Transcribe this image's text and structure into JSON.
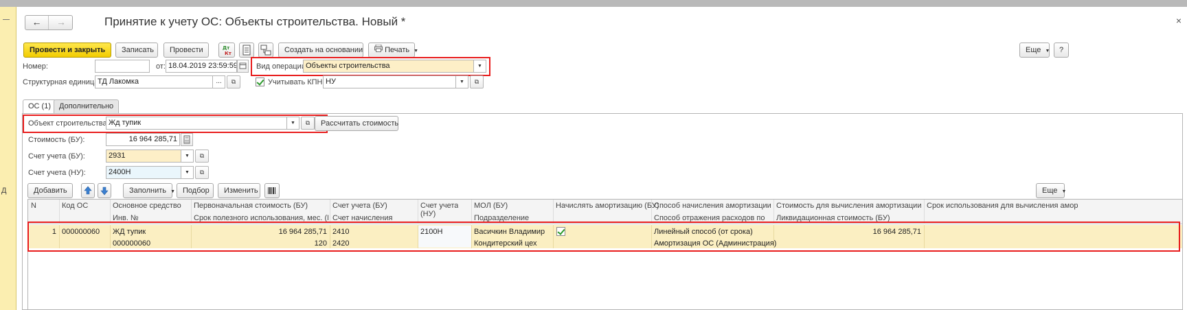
{
  "left_panel": {
    "letter": "Д"
  },
  "header": {
    "title": "Принятие к учету ОС: Объекты строительства. Новый *",
    "back_icon": "arrow-left-icon",
    "forward_icon": "arrow-right-icon",
    "close_glyph": "×"
  },
  "toolbar": {
    "post_close": "Провести и закрыть",
    "save": "Записать",
    "post": "Провести",
    "create_based": "Создать на основании",
    "print": "Печать",
    "more": "Еще",
    "help": "?"
  },
  "form": {
    "number_label": "Номер:",
    "number_value": "",
    "date_label": "от:",
    "date_value": "18.04.2019 23:59:59",
    "operation_label": "Вид операции:",
    "operation_value": "Объекты строительства",
    "unit_label": "Структурная единица:",
    "unit_value": "ТД Лакомка",
    "kpn_label": "Учитывать КПН",
    "kpn_checked": true,
    "kpn_value": "НУ"
  },
  "tabs": [
    {
      "label": "ОС (1)",
      "active": true
    },
    {
      "label": "Дополнительно",
      "active": false
    }
  ],
  "os_tab": {
    "object_label": "Объект строительства:",
    "object_value": "Жд тупик",
    "calc_button": "Рассчитать стоимость",
    "cost_label": "Стоимость (БУ):",
    "cost_value": "16 964 285,71",
    "account_bu_label": "Счет учета (БУ):",
    "account_bu_value": "2931",
    "account_nu_label": "Счет учета (НУ):",
    "account_nu_value": "2400Н"
  },
  "table_toolbar": {
    "add": "Добавить",
    "fill": "Заполнить",
    "select": "Подбор",
    "change": "Изменить",
    "more": "Еще"
  },
  "table": {
    "headers": {
      "n": "N",
      "code": "Код ОС",
      "asset": "Основное средство",
      "inv": "Инв. №",
      "initial_cost": "Первоначальная стоимость (БУ)",
      "useful_life": "Срок полезного использования, мес. (БУ)",
      "account_bu": "Счет учета (БУ)",
      "depr_account": "Счет начисления",
      "account_nu_1": "Счет учета",
      "account_nu_2": "(НУ)",
      "mol": "МОЛ (БУ)",
      "division": "Подразделение",
      "accrue": "Начислять амортизацию (БУ)",
      "method": "Способ начисления амортизации (...",
      "expense_method": "Способ отражения расходов по",
      "depr_cost": "Стоимость для вычисления амортизации (БУ)",
      "salvage": "Ликвидационная стоимость (БУ)",
      "term": "Срок использования для вычисления амор"
    },
    "rows": [
      {
        "n": "1",
        "code": "000000060",
        "asset": "ЖД тупик",
        "inv": "000000060",
        "initial_cost": "16 964 285,71",
        "useful_life": "120",
        "account_bu": "2410",
        "depr_account": "2420",
        "account_nu": "2100Н",
        "mol": "Васичкин Владимир",
        "division": "Кондитерский цех",
        "accrue": true,
        "method": "Линейный способ (от срока)",
        "expense_method": "Амортизация ОС (Администрация)",
        "depr_cost": "16 964 285,71",
        "salvage": "",
        "term": ""
      }
    ]
  },
  "colors": {
    "primary_button": "#f2cc00",
    "highlight_border": "#e81b1b",
    "selected_row": "#fbefc2",
    "side_panel": "#fbeeb0"
  }
}
